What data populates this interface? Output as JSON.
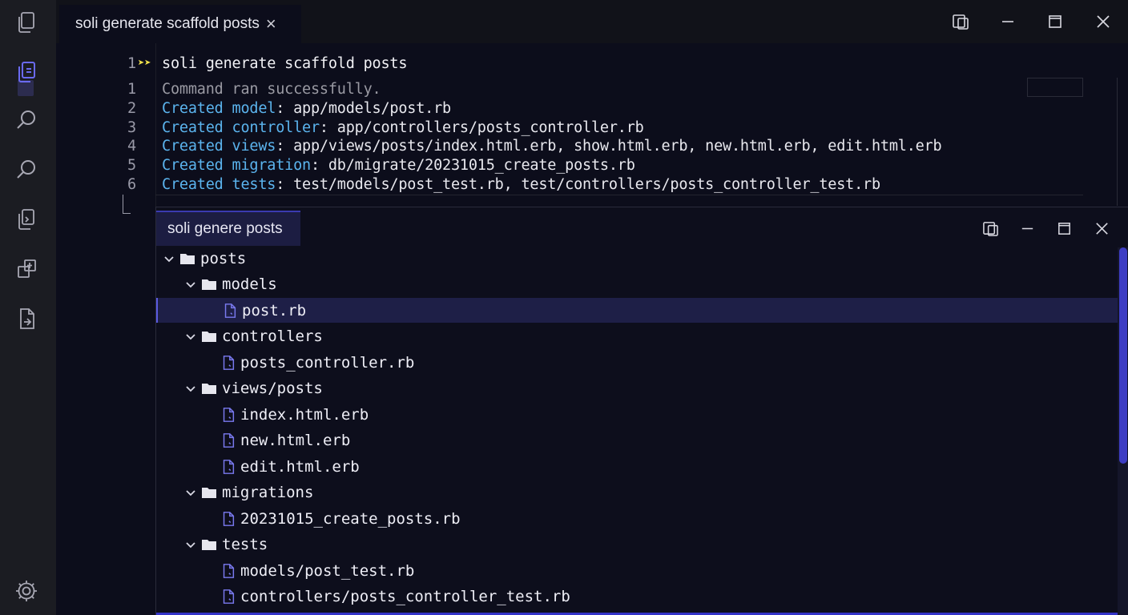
{
  "colors": {
    "accent": "#5a5ae0",
    "keyword": "#5bb4ee",
    "arrow": "#f2e24b",
    "background": "#0c0d1b",
    "activity_bar": "#1b1c22"
  },
  "activity_bar": {
    "items": [
      {
        "name": "explorer-icon"
      },
      {
        "name": "copy-files-icon",
        "active": true
      },
      {
        "name": "search-icon"
      },
      {
        "name": "search-alt-icon"
      },
      {
        "name": "source-files-icon"
      },
      {
        "name": "extensions-icon"
      },
      {
        "name": "file-export-icon"
      }
    ],
    "settings": {
      "name": "gear-icon"
    }
  },
  "editor": {
    "tab_title": "soli generate scaffold posts",
    "command": {
      "line_number": "1",
      "text": "soli generate scaffold posts"
    },
    "output": [
      {
        "line": "1",
        "kw": "",
        "rest": "Command ran successfully."
      },
      {
        "line": "2",
        "kw": "Created model",
        "rest": ": app/models/post.rb"
      },
      {
        "line": "3",
        "kw": "Created controller",
        "rest": ": app/controllers/posts_controller.rb"
      },
      {
        "line": "4",
        "kw": "Created views",
        "rest": ": app/views/posts/index.html.erb, show.html.erb, new.html.erb, edit.html.erb"
      },
      {
        "line": "5",
        "kw": "Created migration",
        "rest": ": db/migrate/20231015_create_posts.rb"
      },
      {
        "line": "6",
        "kw": "Created tests",
        "rest": ": test/models/post_test.rb, test/controllers/posts_controller_test.rb"
      }
    ]
  },
  "panel": {
    "tab_title": "soli genere posts",
    "tree": [
      {
        "label": "posts",
        "type": "folder",
        "depth": 0
      },
      {
        "label": "models",
        "type": "folder",
        "depth": 1
      },
      {
        "label": "post.rb",
        "type": "file",
        "depth": 2,
        "selected": true
      },
      {
        "label": "controllers",
        "type": "folder",
        "depth": 1
      },
      {
        "label": "posts_controller.rb",
        "type": "file",
        "depth": 2
      },
      {
        "label": "views/posts",
        "type": "folder",
        "depth": 1
      },
      {
        "label": "index.html.erb",
        "type": "file",
        "depth": 2
      },
      {
        "label": "new.html.erb",
        "type": "file",
        "depth": 2
      },
      {
        "label": "edit.html.erb",
        "type": "file",
        "depth": 2
      },
      {
        "label": "migrations",
        "type": "folder",
        "depth": 1
      },
      {
        "label": "20231015_create_posts.rb",
        "type": "file",
        "depth": 2
      },
      {
        "label": "tests",
        "type": "folder",
        "depth": 1
      },
      {
        "label": "models/post_test.rb",
        "type": "file",
        "depth": 2
      },
      {
        "label": "controllers/posts_controller_test.rb",
        "type": "file",
        "depth": 2
      }
    ]
  }
}
